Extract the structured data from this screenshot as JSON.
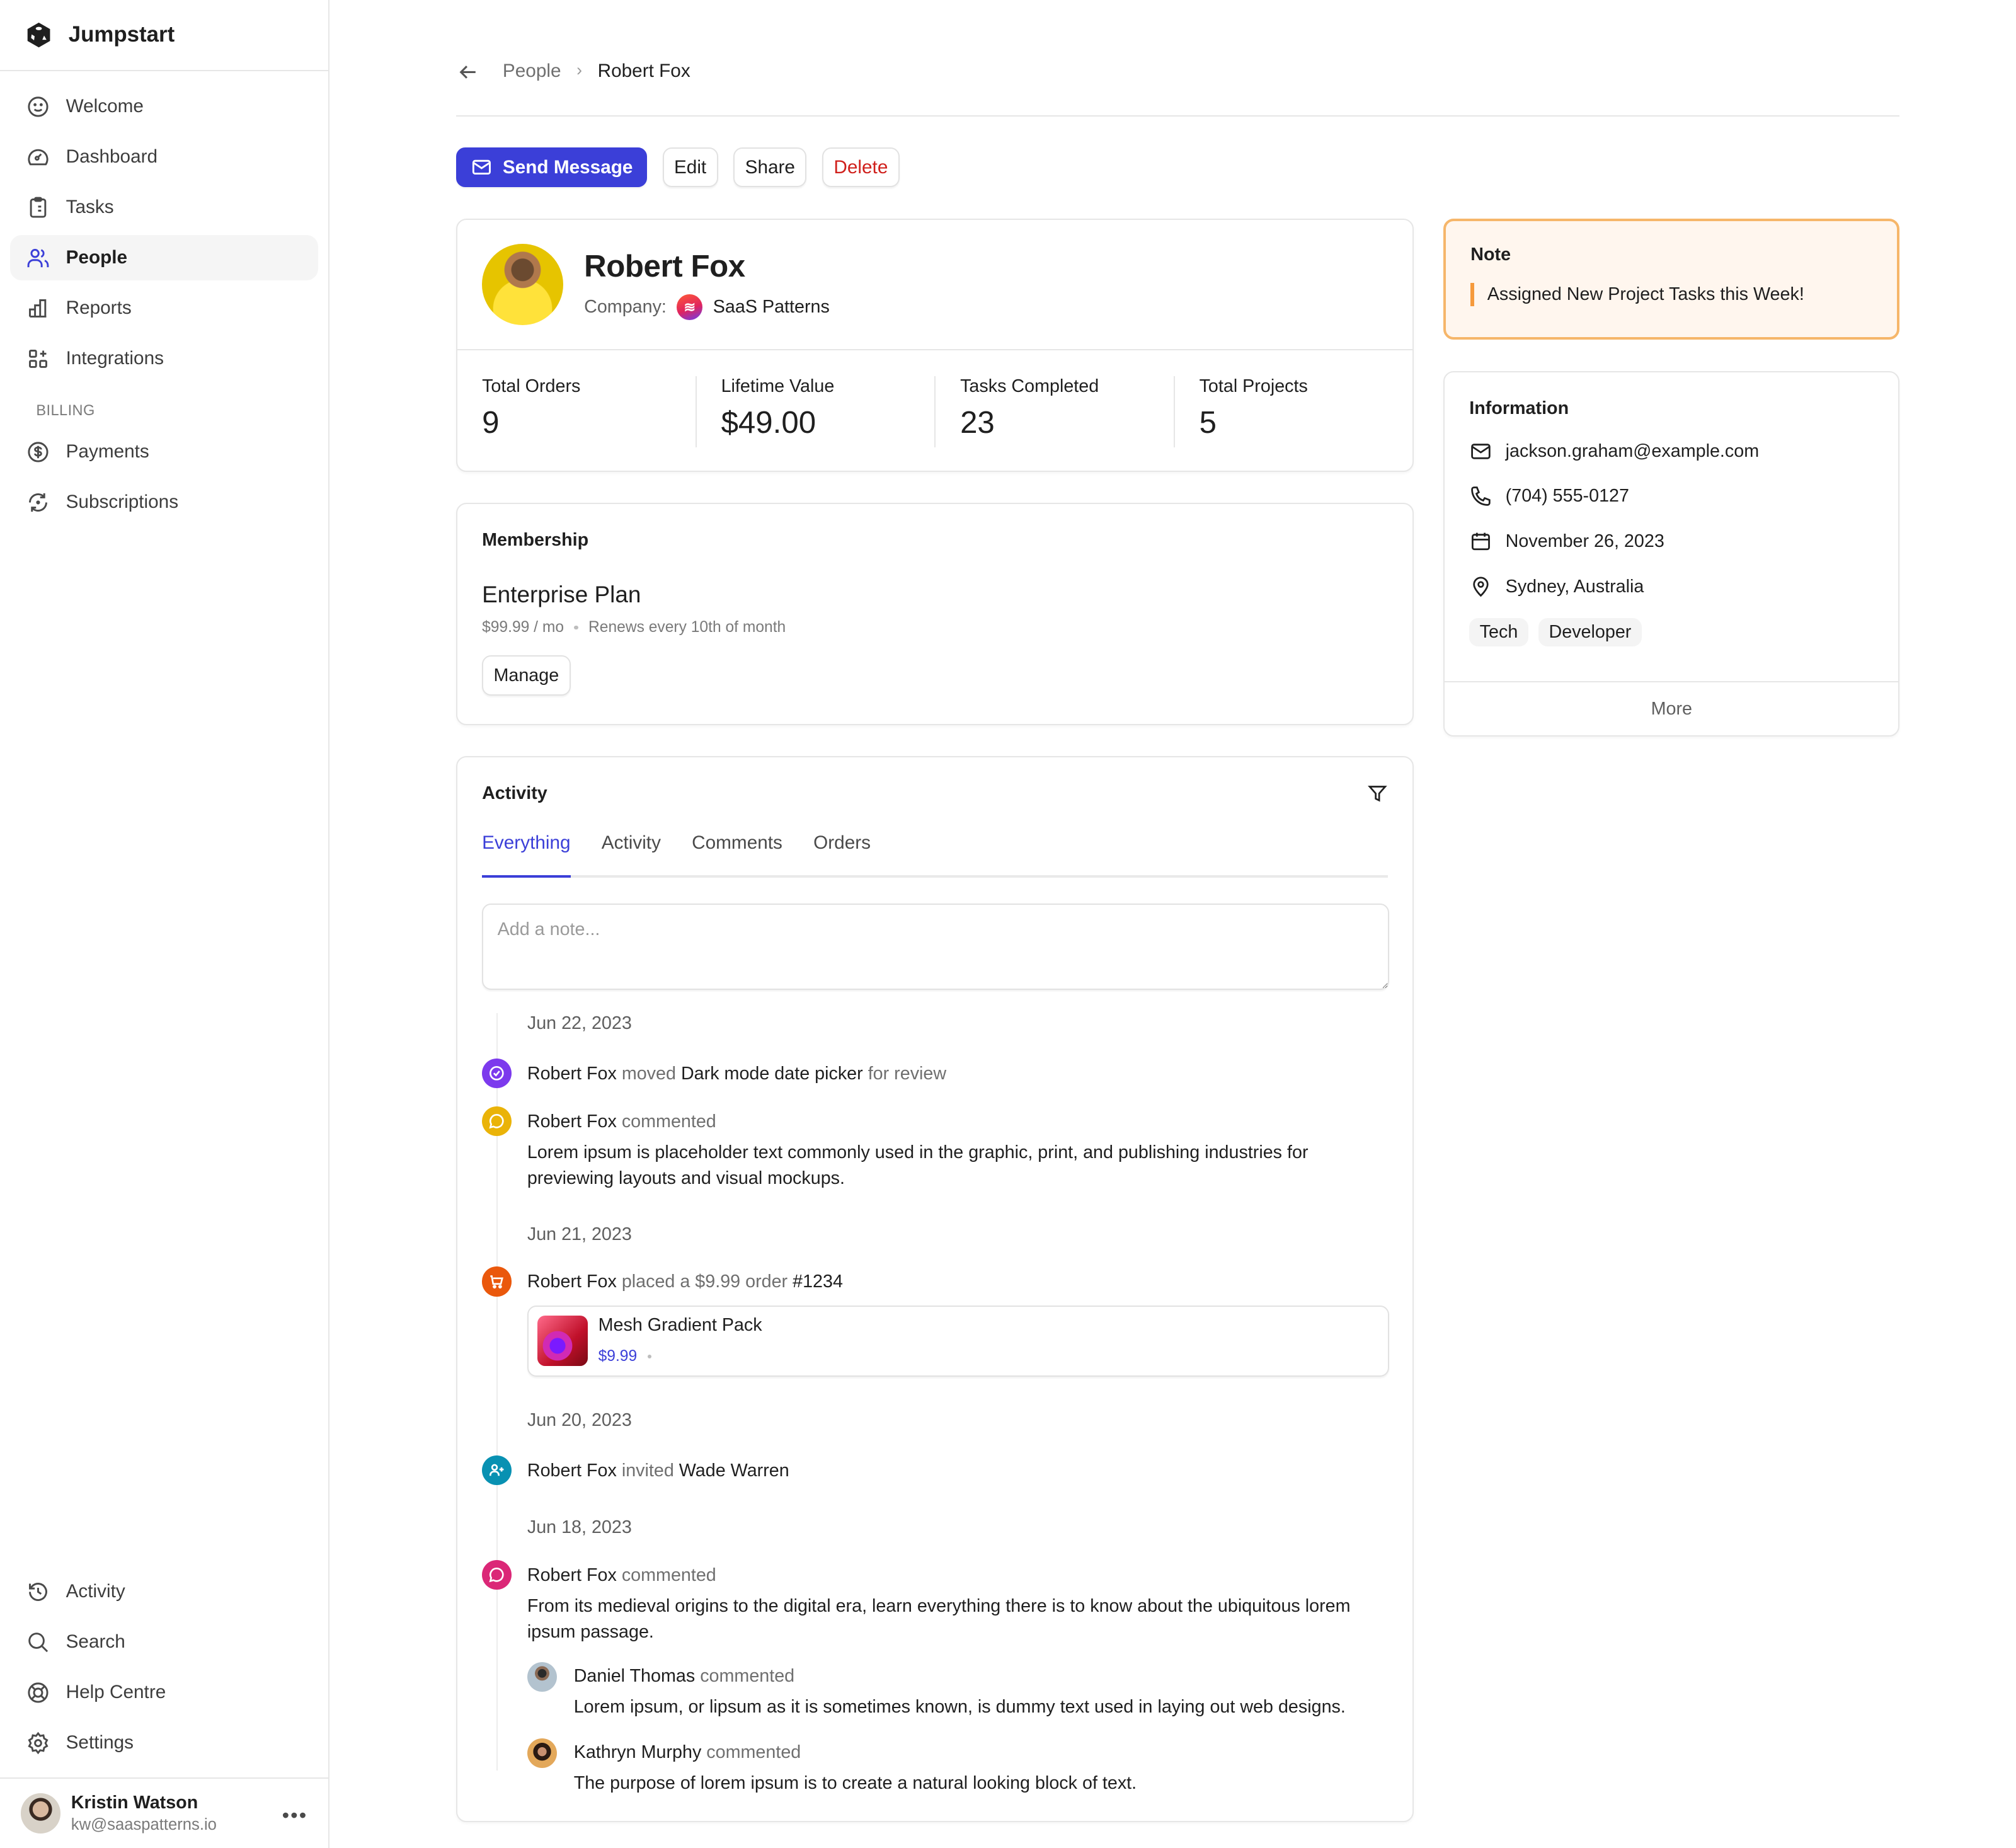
{
  "app": {
    "name": "Jumpstart"
  },
  "sidebar": {
    "items": [
      {
        "label": "Welcome",
        "icon": "smile-icon"
      },
      {
        "label": "Dashboard",
        "icon": "gauge-icon"
      },
      {
        "label": "Tasks",
        "icon": "clipboard-icon"
      },
      {
        "label": "People",
        "icon": "users-icon",
        "active": true
      },
      {
        "label": "Reports",
        "icon": "bar-chart-icon"
      },
      {
        "label": "Integrations",
        "icon": "grid-plus-icon"
      }
    ],
    "billing_label": "BILLING",
    "billing_items": [
      {
        "label": "Payments",
        "icon": "dollar-circle-icon"
      },
      {
        "label": "Subscriptions",
        "icon": "refresh-icon"
      }
    ],
    "bottom_items": [
      {
        "label": "Activity",
        "icon": "history-icon"
      },
      {
        "label": "Search",
        "icon": "search-icon"
      },
      {
        "label": "Help Centre",
        "icon": "lifebuoy-icon"
      },
      {
        "label": "Settings",
        "icon": "gear-icon"
      }
    ],
    "user": {
      "name": "Kristin Watson",
      "email": "kw@saaspatterns.io",
      "more": "•••"
    }
  },
  "breadcrumb": {
    "parent": "People",
    "separator": "›",
    "current": "Robert Fox"
  },
  "toolbar": {
    "send_message": "Send Message",
    "edit": "Edit",
    "share": "Share",
    "delete": "Delete"
  },
  "profile": {
    "name": "Robert Fox",
    "company_label": "Company:",
    "company_name": "SaaS Patterns",
    "stats": [
      {
        "label": "Total Orders",
        "value": "9"
      },
      {
        "label": "Lifetime Value",
        "value": "$49.00"
      },
      {
        "label": "Tasks Completed",
        "value": "23"
      },
      {
        "label": "Total Projects",
        "value": "5"
      }
    ]
  },
  "membership": {
    "title": "Membership",
    "plan": "Enterprise Plan",
    "price": "$99.99 / mo",
    "renewal": "Renews every 10th of month",
    "manage": "Manage"
  },
  "activity": {
    "title": "Activity",
    "tabs": [
      "Everything",
      "Activity",
      "Comments",
      "Orders"
    ],
    "active_tab": "Everything",
    "note_placeholder": "Add a note...",
    "groups": [
      {
        "date": "Jun 22, 2023"
      },
      {
        "date": "Jun 21, 2023"
      },
      {
        "date": "Jun 20, 2023"
      },
      {
        "date": "Jun 18, 2023"
      }
    ],
    "e1": {
      "actor": "Robert Fox",
      "verb": "moved",
      "object": "Dark mode date picker",
      "suffix": "for review",
      "icon_color": "#7c3aed"
    },
    "e2": {
      "actor": "Robert Fox",
      "verb": "commented",
      "body": "Lorem ipsum is placeholder text commonly used in the graphic, print, and publishing industries for previewing layouts and visual mockups.",
      "icon_color": "#eab308"
    },
    "e3": {
      "actor": "Robert Fox",
      "verb": "placed a $9.99 order",
      "object": "#1234",
      "product": "Mesh Gradient Pack",
      "product_price": "$9.99",
      "icon_color": "#ea580c"
    },
    "e4": {
      "actor": "Robert Fox",
      "verb": "invited",
      "object": "Wade Warren",
      "icon_color": "#0891b2"
    },
    "e5": {
      "actor": "Robert Fox",
      "verb": "commented",
      "body": "From its medieval origins to the digital era, learn everything there is to know about the ubiquitous lorem ipsum passage.",
      "icon_color": "#db2777",
      "replies": [
        {
          "name": "Daniel Thomas",
          "verb": "commented",
          "body": "Lorem ipsum, or lipsum as it is sometimes known, is dummy text used in laying out web designs."
        },
        {
          "name": "Kathryn Murphy",
          "verb": "commented",
          "body": "The purpose of lorem ipsum is to create a natural looking block of text."
        }
      ]
    }
  },
  "note": {
    "title": "Note",
    "text": "Assigned New Project Tasks this Week!"
  },
  "information": {
    "title": "Information",
    "email": "jackson.graham@example.com",
    "phone": "(704) 555-0127",
    "date": "November 26, 2023",
    "location": "Sydney, Australia",
    "tags": [
      "Tech",
      "Developer"
    ],
    "more": "More"
  },
  "colors": {
    "accent": "#3b3fd8",
    "danger": "#d0201c",
    "note_border": "#f6b66a",
    "note_bg": "#fff6ee"
  }
}
